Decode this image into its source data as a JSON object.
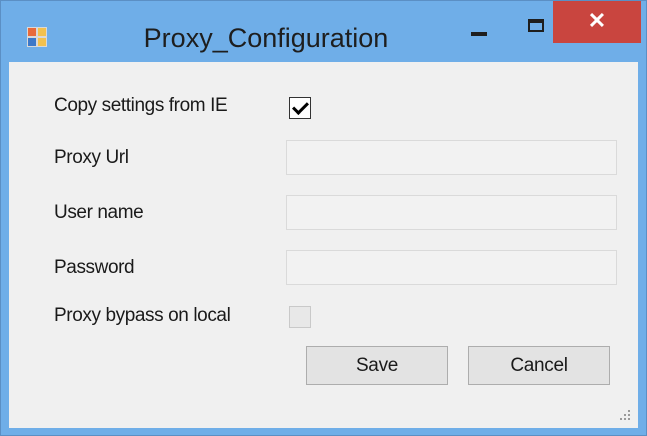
{
  "window": {
    "title": "Proxy_Configuration",
    "close_glyph": "✕",
    "controls": [
      "minimize-icon",
      "maximize-icon",
      "close-icon"
    ]
  },
  "form": {
    "copy_settings_label": "Copy settings from IE",
    "copy_settings_checked": true,
    "proxy_url_label": "Proxy Url",
    "proxy_url_value": "",
    "username_label": "User name",
    "username_value": "",
    "password_label": "Password",
    "password_value": "",
    "bypass_label": "Proxy bypass on local",
    "bypass_checked": false
  },
  "buttons": {
    "save_label": "Save",
    "cancel_label": "Cancel"
  },
  "colors": {
    "title_bar": "#6faee8",
    "close_button": "#c9453f",
    "client_background": "#f0f0f0"
  }
}
